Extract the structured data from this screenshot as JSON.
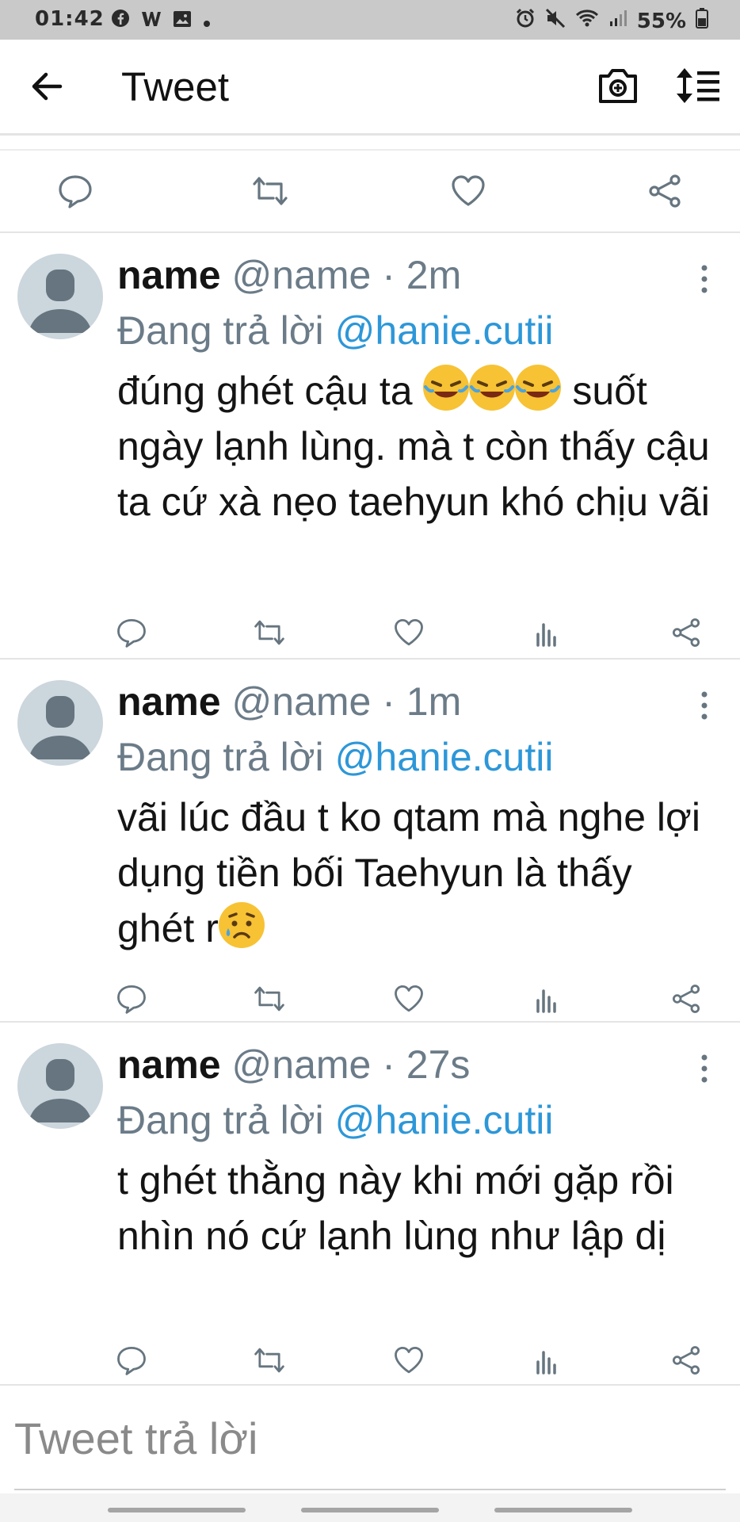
{
  "status_bar": {
    "time": "01:42",
    "battery": "55%",
    "left_icons": [
      "facebook-icon",
      "w-app-icon",
      "gallery-icon",
      "dot-icon"
    ],
    "right_icons": [
      "alarm-icon",
      "mute-icon",
      "wifi-icon",
      "signal-icon",
      "battery-icon"
    ]
  },
  "header": {
    "title": "Tweet"
  },
  "tweets": [
    {
      "name": "name",
      "handle": "@name · 2m",
      "replying_prefix": "Đang trả lời ",
      "mention": "@hanie.cutii",
      "text_before_emoji": "đúng ghét cậu ta ",
      "text_after_emoji": "suốt ngày lạnh lùng. mà t còn thấy cậu ta cứ xà nẹo taehyun khó chịu vãi",
      "emojis": [
        "rofl-emoji",
        "rofl-emoji",
        "rofl-emoji"
      ]
    },
    {
      "name": "name",
      "handle": "@name · 1m",
      "replying_prefix": "Đang trả lời ",
      "mention": "@hanie.cutii",
      "text": "vãi lúc đầu t ko qtam mà nghe lợi dụng tiền bối Taehyun là thấy ghét r",
      "emojis": [
        "sad-tear-emoji"
      ]
    },
    {
      "name": "name",
      "handle": "@name · 27s",
      "replying_prefix": "Đang trả lời ",
      "mention": "@hanie.cutii",
      "text": "t ghét thằng này khi mới gặp rồi nhìn nó cứ lạnh lùng như lập dị"
    }
  ],
  "reply_box": {
    "placeholder": "Tweet trả lời",
    "value": ""
  },
  "colors": {
    "accent": "#2d97d8",
    "muted": "#6b7b88",
    "divider": "#e4e4e4",
    "avatar_bg": "#ccd6dd",
    "avatar_fg": "#66757f"
  }
}
